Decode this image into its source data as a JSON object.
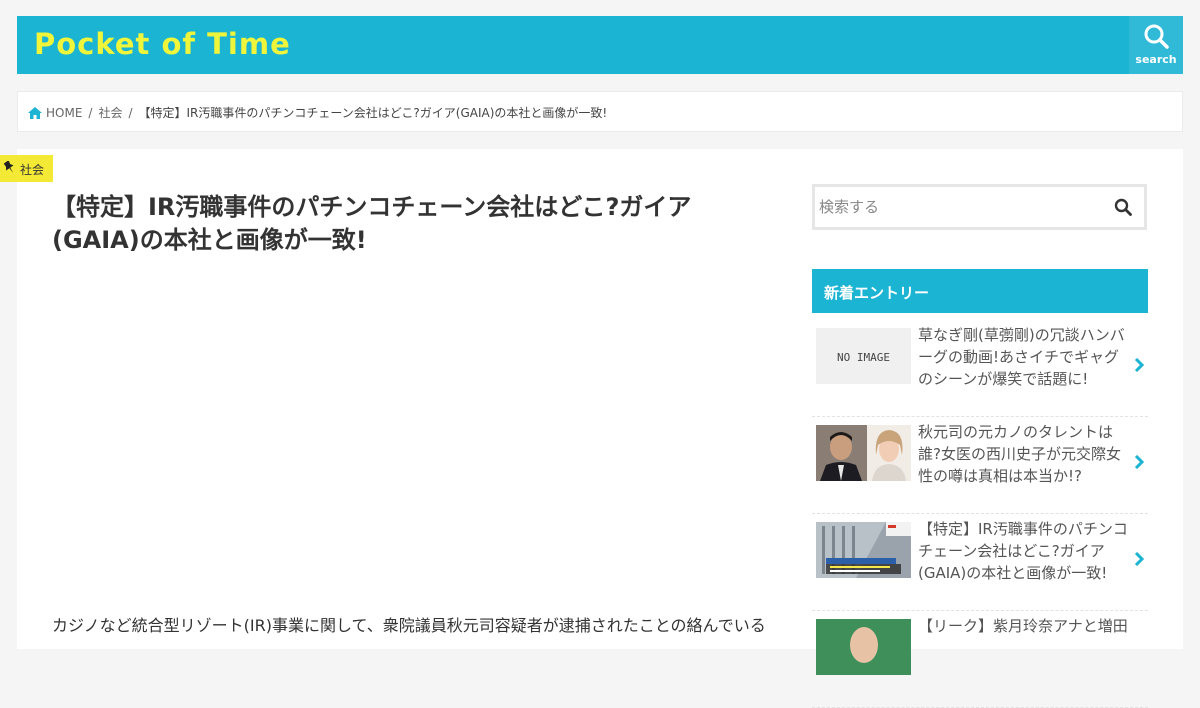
{
  "header": {
    "logo": "Pocket of Time",
    "search_label": "search",
    "bg_color": "#1bb4d3",
    "logo_color": "#eef53b"
  },
  "breadcrumb": {
    "home": "HOME",
    "category": "社会",
    "current": "【特定】IR汚職事件のパチンコチェーン会社はどこ?ガイア(GAIA)の本社と画像が一致!",
    "separator": "/"
  },
  "article": {
    "category_tag": "社会",
    "title": "【特定】IR汚職事件のパチンコチェーン会社はどこ?ガイア(GAIA)の本社と画像が一致!",
    "body_first_line": "カジノなど統合型リゾート(IR)事業に関して、衆院議員秋元司容疑者が逮捕されたことの絡んでいる"
  },
  "sidebar": {
    "search_placeholder": "検索する",
    "new_entries_heading": "新着エントリー",
    "entries": [
      {
        "thumb": "NO IMAGE",
        "text": "草なぎ剛(草彅剛)の冗談ハンバーグの動画!あさイチでギャグのシーンが爆笑で話題に!"
      },
      {
        "thumb": "",
        "text": "秋元司の元カノのタレントは誰?女医の西川史子が元交際女性の噂は真相は本当か!?"
      },
      {
        "thumb": "",
        "text": "【特定】IR汚職事件のパチンコチェーン会社はどこ?ガイア(GAIA)の本社と画像が一致!"
      },
      {
        "thumb": "",
        "text": "【リーク】紫月玲奈アナと増田"
      }
    ]
  },
  "icons": {
    "search": "search-icon",
    "home": "home-icon",
    "pin": "pin-icon",
    "chevron": "chevron-right-icon"
  }
}
